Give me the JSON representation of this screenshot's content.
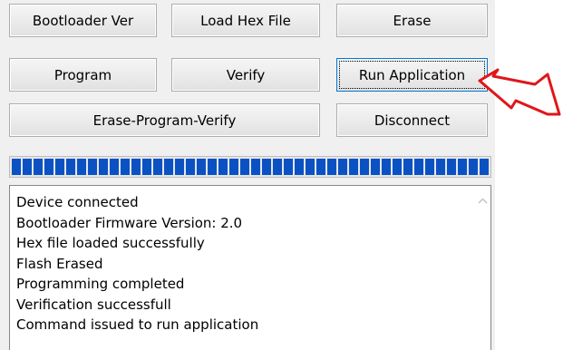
{
  "buttons": {
    "bootloader_ver": "Bootloader Ver",
    "load_hex_file": "Load Hex File",
    "erase": "Erase",
    "program": "Program",
    "verify": "Verify",
    "run_application": "Run Application",
    "erase_program_verify": "Erase-Program-Verify",
    "disconnect": "Disconnect"
  },
  "progress": {
    "fraction": 1.0
  },
  "log": {
    "lines": [
      "Device connected",
      "Bootloader Firmware Version: 2.0",
      "Hex file loaded successfully",
      "Flash Erased",
      "Programming completed",
      "Verification successfull",
      "Command issued to run application"
    ]
  },
  "annotation": {
    "icon": "red-arrow-icon",
    "color": "#e0161a"
  },
  "colors": {
    "progress": "#0a52c4",
    "focus_border": "#0078d7"
  }
}
